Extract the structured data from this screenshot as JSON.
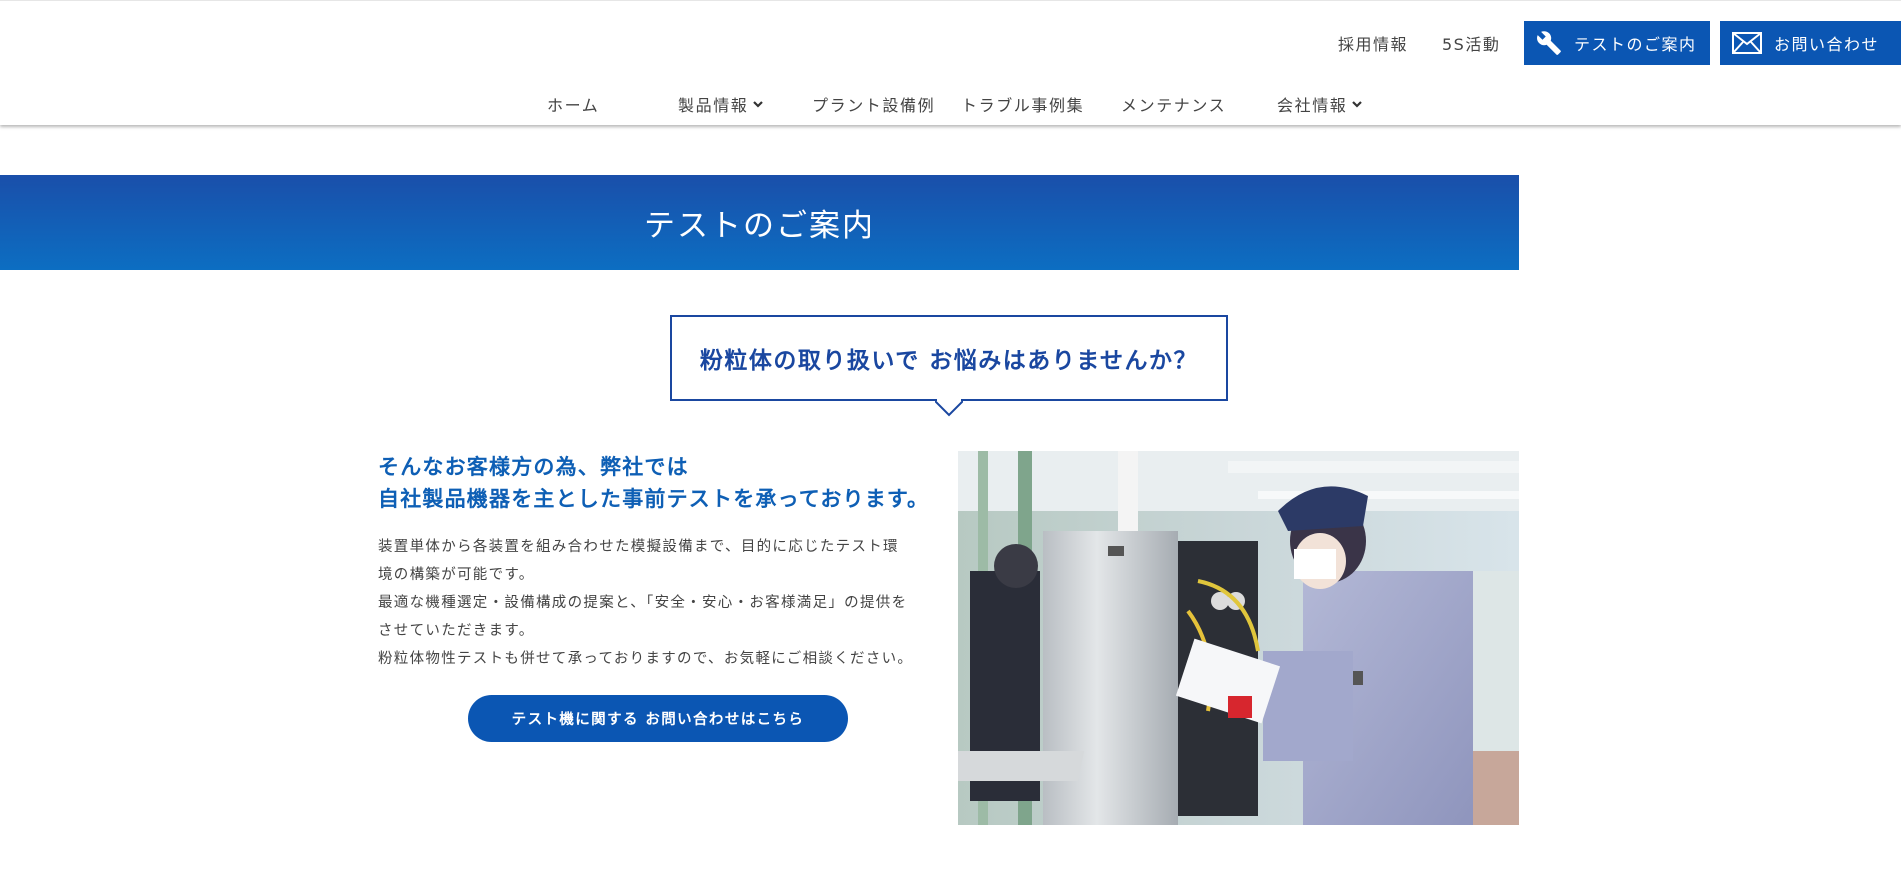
{
  "header": {
    "utility_links": [
      "採用情報",
      "5S活動"
    ],
    "test_button_label": "テストのご案内",
    "contact_button_label": "お問い合わせ",
    "nav": [
      {
        "label": "ホーム",
        "has_dropdown": false
      },
      {
        "label": "製品情報",
        "has_dropdown": true
      },
      {
        "label": "プラント設備例",
        "has_dropdown": false
      },
      {
        "label": "トラブル事例集",
        "has_dropdown": false
      },
      {
        "label": "メンテナンス",
        "has_dropdown": false
      },
      {
        "label": "会社情報",
        "has_dropdown": true
      }
    ]
  },
  "hero": {
    "title": "テストのご案内"
  },
  "bubble": {
    "text": "粉粒体の取り扱いで お悩みはありませんか？"
  },
  "lead": {
    "line1": "そんなお客様方の為、弊社では",
    "line2": "自社製品機器を主とした事前テストを承っております。"
  },
  "body": {
    "lines": [
      "装置単体から各装置を組み合わせた模擬設備まで、目的に応じたテスト環",
      "境の構築が可能です。",
      "最適な機種選定・設備構成の提案と、「安全・安心・お客様満足」の提供を",
      "させていただきます。",
      "粉粒体物性テストも併せて承っておりますので、お気軽にご相談ください。"
    ]
  },
  "cta": {
    "label": "テスト機に関する お問い合わせはこちら"
  },
  "colors": {
    "brand_blue": "#0b56b3",
    "heading_blue": "#1a47a0",
    "hero_gradient": [
      "#1a4faa",
      "#0c6ec2"
    ]
  },
  "icons": [
    "wrench-icon",
    "envelope-icon",
    "chevron-down-icon"
  ]
}
